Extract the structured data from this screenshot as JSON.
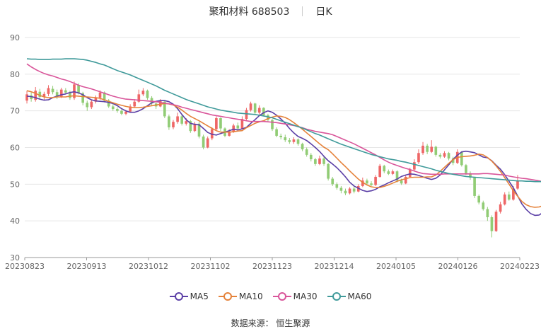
{
  "header": {
    "title": "聚和材料 688503",
    "period": "日K"
  },
  "source": "数据来源： 恒生聚源",
  "colors": {
    "up": "#ee6666",
    "down": "#91cc75",
    "ma5": "#5b3fa6",
    "ma10": "#e5823a",
    "ma30": "#d9559a",
    "ma60": "#3f9a9a",
    "grid": "#e6e6e6",
    "axis": "#666666"
  },
  "chart_data": {
    "type": "candlestick",
    "title": "聚和材料 688503",
    "subtitle": "日K",
    "ylim": [
      30,
      90
    ],
    "yticks": [
      30,
      40,
      50,
      60,
      70,
      80,
      90
    ],
    "xticks": [
      "20230823",
      "20230913",
      "20231012",
      "20231102",
      "20231123",
      "20231214",
      "20240105",
      "20240126",
      "20240223"
    ],
    "legend_position": "bottom",
    "grid": true,
    "candles": [
      {
        "o": 72.8,
        "c": 74.5,
        "h": 75.5,
        "l": 72.0
      },
      {
        "o": 74.2,
        "c": 73.2,
        "h": 75.0,
        "l": 72.5
      },
      {
        "o": 73.0,
        "c": 75.5,
        "h": 76.5,
        "l": 72.5
      },
      {
        "o": 75.2,
        "c": 73.8,
        "h": 76.0,
        "l": 73.2
      },
      {
        "o": 73.8,
        "c": 74.6,
        "h": 75.2,
        "l": 73.0
      },
      {
        "o": 74.6,
        "c": 76.2,
        "h": 77.0,
        "l": 74.0
      },
      {
        "o": 76.0,
        "c": 75.1,
        "h": 76.8,
        "l": 74.5
      },
      {
        "o": 75.1,
        "c": 73.8,
        "h": 75.8,
        "l": 73.2
      },
      {
        "o": 73.8,
        "c": 75.8,
        "h": 76.3,
        "l": 73.5
      },
      {
        "o": 75.6,
        "c": 75.0,
        "h": 76.2,
        "l": 74.5
      },
      {
        "o": 75.0,
        "c": 73.5,
        "h": 75.5,
        "l": 73.0
      },
      {
        "o": 73.5,
        "c": 77.2,
        "h": 78.0,
        "l": 73.0
      },
      {
        "o": 77.0,
        "c": 74.8,
        "h": 77.5,
        "l": 74.5
      },
      {
        "o": 74.8,
        "c": 72.2,
        "h": 75.2,
        "l": 71.5
      },
      {
        "o": 72.2,
        "c": 71.0,
        "h": 72.8,
        "l": 70.0
      },
      {
        "o": 71.0,
        "c": 72.5,
        "h": 73.0,
        "l": 70.5
      },
      {
        "o": 72.5,
        "c": 73.6,
        "h": 74.2,
        "l": 72.0
      },
      {
        "o": 73.6,
        "c": 75.0,
        "h": 75.6,
        "l": 73.0
      },
      {
        "o": 75.0,
        "c": 72.8,
        "h": 75.3,
        "l": 72.3
      },
      {
        "o": 72.8,
        "c": 71.2,
        "h": 73.2,
        "l": 70.8
      },
      {
        "o": 71.2,
        "c": 70.5,
        "h": 71.8,
        "l": 70.0
      },
      {
        "o": 70.5,
        "c": 70.0,
        "h": 71.0,
        "l": 69.5
      },
      {
        "o": 70.0,
        "c": 69.2,
        "h": 70.6,
        "l": 68.8
      },
      {
        "o": 69.2,
        "c": 69.8,
        "h": 70.2,
        "l": 68.8
      },
      {
        "o": 69.8,
        "c": 71.2,
        "h": 71.8,
        "l": 69.5
      },
      {
        "o": 71.2,
        "c": 72.5,
        "h": 73.2,
        "l": 71.0
      },
      {
        "o": 72.5,
        "c": 74.5,
        "h": 75.8,
        "l": 72.2
      },
      {
        "o": 74.5,
        "c": 75.5,
        "h": 76.2,
        "l": 74.0
      },
      {
        "o": 75.5,
        "c": 73.5,
        "h": 75.8,
        "l": 73.0
      },
      {
        "o": 73.5,
        "c": 72.0,
        "h": 74.0,
        "l": 71.5
      },
      {
        "o": 72.0,
        "c": 71.2,
        "h": 72.5,
        "l": 70.5
      },
      {
        "o": 71.2,
        "c": 72.8,
        "h": 73.2,
        "l": 71.0
      },
      {
        "o": 72.5,
        "c": 68.5,
        "h": 72.8,
        "l": 68.0
      },
      {
        "o": 68.5,
        "c": 65.5,
        "h": 69.0,
        "l": 64.8
      },
      {
        "o": 65.5,
        "c": 67.0,
        "h": 67.5,
        "l": 65.0
      },
      {
        "o": 67.0,
        "c": 68.5,
        "h": 69.5,
        "l": 66.5
      },
      {
        "o": 68.5,
        "c": 66.5,
        "h": 69.0,
        "l": 66.0
      },
      {
        "o": 66.5,
        "c": 67.2,
        "h": 68.0,
        "l": 66.0
      },
      {
        "o": 67.2,
        "c": 64.5,
        "h": 67.5,
        "l": 64.0
      },
      {
        "o": 64.5,
        "c": 66.5,
        "h": 67.0,
        "l": 64.2
      },
      {
        "o": 66.5,
        "c": 63.0,
        "h": 67.0,
        "l": 62.5
      },
      {
        "o": 63.0,
        "c": 60.0,
        "h": 63.5,
        "l": 59.5
      },
      {
        "o": 60.0,
        "c": 62.5,
        "h": 63.0,
        "l": 59.8
      },
      {
        "o": 62.5,
        "c": 65.0,
        "h": 65.5,
        "l": 62.0
      },
      {
        "o": 65.0,
        "c": 68.0,
        "h": 68.5,
        "l": 64.5
      },
      {
        "o": 68.0,
        "c": 65.2,
        "h": 68.2,
        "l": 64.5
      },
      {
        "o": 65.2,
        "c": 63.2,
        "h": 65.5,
        "l": 62.8
      },
      {
        "o": 63.2,
        "c": 64.2,
        "h": 65.0,
        "l": 63.0
      },
      {
        "o": 64.2,
        "c": 66.0,
        "h": 66.5,
        "l": 64.0
      },
      {
        "o": 66.0,
        "c": 65.2,
        "h": 66.8,
        "l": 64.8
      },
      {
        "o": 65.2,
        "c": 67.8,
        "h": 68.5,
        "l": 65.0
      },
      {
        "o": 67.8,
        "c": 70.2,
        "h": 70.8,
        "l": 67.5
      },
      {
        "o": 70.2,
        "c": 72.0,
        "h": 72.5,
        "l": 69.8
      },
      {
        "o": 72.0,
        "c": 69.5,
        "h": 72.2,
        "l": 69.0
      },
      {
        "o": 69.5,
        "c": 70.8,
        "h": 71.5,
        "l": 69.0
      },
      {
        "o": 70.8,
        "c": 68.8,
        "h": 71.0,
        "l": 68.5
      },
      {
        "o": 68.8,
        "c": 67.5,
        "h": 69.2,
        "l": 67.0
      },
      {
        "o": 67.5,
        "c": 65.0,
        "h": 67.8,
        "l": 64.5
      },
      {
        "o": 65.0,
        "c": 63.2,
        "h": 65.5,
        "l": 62.8
      },
      {
        "o": 63.2,
        "c": 62.8,
        "h": 63.8,
        "l": 62.2
      },
      {
        "o": 62.8,
        "c": 62.0,
        "h": 63.5,
        "l": 61.5
      },
      {
        "o": 62.0,
        "c": 61.5,
        "h": 62.6,
        "l": 61.0
      },
      {
        "o": 61.5,
        "c": 62.2,
        "h": 62.8,
        "l": 61.0
      },
      {
        "o": 62.2,
        "c": 61.0,
        "h": 62.5,
        "l": 60.5
      },
      {
        "o": 61.0,
        "c": 59.5,
        "h": 61.3,
        "l": 59.0
      },
      {
        "o": 59.5,
        "c": 58.0,
        "h": 60.0,
        "l": 57.5
      },
      {
        "o": 58.0,
        "c": 56.8,
        "h": 58.5,
        "l": 56.2
      },
      {
        "o": 56.8,
        "c": 55.5,
        "h": 57.2,
        "l": 55.0
      },
      {
        "o": 55.5,
        "c": 57.0,
        "h": 57.8,
        "l": 55.2
      },
      {
        "o": 57.0,
        "c": 55.5,
        "h": 57.5,
        "l": 55.0
      },
      {
        "o": 55.5,
        "c": 51.5,
        "h": 55.8,
        "l": 51.0
      },
      {
        "o": 51.5,
        "c": 50.0,
        "h": 52.0,
        "l": 49.5
      },
      {
        "o": 50.0,
        "c": 49.0,
        "h": 50.5,
        "l": 48.5
      },
      {
        "o": 49.0,
        "c": 48.2,
        "h": 49.5,
        "l": 47.5
      },
      {
        "o": 48.2,
        "c": 47.5,
        "h": 48.8,
        "l": 47.0
      },
      {
        "o": 47.5,
        "c": 48.8,
        "h": 49.2,
        "l": 47.2
      },
      {
        "o": 48.8,
        "c": 48.0,
        "h": 49.5,
        "l": 47.5
      },
      {
        "o": 48.0,
        "c": 49.5,
        "h": 50.0,
        "l": 47.8
      },
      {
        "o": 49.5,
        "c": 51.0,
        "h": 51.8,
        "l": 49.2
      },
      {
        "o": 51.0,
        "c": 50.2,
        "h": 51.5,
        "l": 49.8
      },
      {
        "o": 50.2,
        "c": 49.8,
        "h": 50.8,
        "l": 49.5
      },
      {
        "o": 49.8,
        "c": 52.0,
        "h": 52.5,
        "l": 49.5
      },
      {
        "o": 52.0,
        "c": 55.0,
        "h": 55.5,
        "l": 51.8
      },
      {
        "o": 55.0,
        "c": 53.5,
        "h": 55.3,
        "l": 53.0
      },
      {
        "o": 53.5,
        "c": 52.8,
        "h": 54.0,
        "l": 52.5
      },
      {
        "o": 52.8,
        "c": 53.5,
        "h": 54.0,
        "l": 52.5
      },
      {
        "o": 53.5,
        "c": 51.0,
        "h": 53.8,
        "l": 50.5
      },
      {
        "o": 51.0,
        "c": 50.2,
        "h": 51.5,
        "l": 49.8
      },
      {
        "o": 50.2,
        "c": 52.0,
        "h": 52.5,
        "l": 50.0
      },
      {
        "o": 52.0,
        "c": 54.0,
        "h": 54.5,
        "l": 51.8
      },
      {
        "o": 54.0,
        "c": 56.0,
        "h": 56.8,
        "l": 53.5
      },
      {
        "o": 56.0,
        "c": 58.5,
        "h": 59.5,
        "l": 55.5
      },
      {
        "o": 58.5,
        "c": 60.5,
        "h": 61.5,
        "l": 58.0
      },
      {
        "o": 60.5,
        "c": 58.8,
        "h": 61.0,
        "l": 58.2
      },
      {
        "o": 58.8,
        "c": 60.2,
        "h": 62.0,
        "l": 58.5
      },
      {
        "o": 60.2,
        "c": 58.0,
        "h": 60.5,
        "l": 57.5
      },
      {
        "o": 58.0,
        "c": 57.5,
        "h": 58.5,
        "l": 57.0
      },
      {
        "o": 57.5,
        "c": 58.5,
        "h": 59.0,
        "l": 57.2
      },
      {
        "o": 58.5,
        "c": 57.0,
        "h": 58.8,
        "l": 56.5
      },
      {
        "o": 57.0,
        "c": 55.8,
        "h": 57.5,
        "l": 55.2
      },
      {
        "o": 55.8,
        "c": 58.8,
        "h": 59.5,
        "l": 55.5
      },
      {
        "o": 58.8,
        "c": 55.2,
        "h": 59.0,
        "l": 54.8
      },
      {
        "o": 55.2,
        "c": 53.0,
        "h": 55.5,
        "l": 52.5
      },
      {
        "o": 53.0,
        "c": 51.8,
        "h": 53.5,
        "l": 51.2
      },
      {
        "o": 51.8,
        "c": 46.8,
        "h": 52.0,
        "l": 46.2
      },
      {
        "o": 46.8,
        "c": 45.0,
        "h": 47.2,
        "l": 44.5
      },
      {
        "o": 45.0,
        "c": 43.2,
        "h": 45.5,
        "l": 42.8
      },
      {
        "o": 43.2,
        "c": 41.0,
        "h": 43.8,
        "l": 40.0
      },
      {
        "o": 41.0,
        "c": 37.2,
        "h": 41.5,
        "l": 35.5
      },
      {
        "o": 37.2,
        "c": 42.5,
        "h": 43.0,
        "l": 37.0
      },
      {
        "o": 42.5,
        "c": 44.5,
        "h": 45.2,
        "l": 42.0
      },
      {
        "o": 44.5,
        "c": 47.2,
        "h": 47.8,
        "l": 44.2
      },
      {
        "o": 47.2,
        "c": 45.8,
        "h": 48.0,
        "l": 45.5
      },
      {
        "o": 45.8,
        "c": 48.8,
        "h": 49.5,
        "l": 45.5
      },
      {
        "o": 48.8,
        "c": 51.0,
        "h": 52.5,
        "l": 48.5
      }
    ],
    "series": [
      {
        "name": "MA5",
        "key": "ma5",
        "values": [
          74.0,
          73.9,
          73.6,
          73.2,
          72.9,
          73.0,
          73.6,
          74.0,
          74.4,
          74.6,
          75.0,
          75.2,
          74.9,
          74.4,
          73.6,
          73.0,
          72.7,
          72.6,
          72.5,
          72.3,
          72.0,
          71.4,
          70.6,
          70.0,
          69.6,
          69.6,
          70.0,
          70.6,
          71.4,
          72.2,
          72.6,
          72.8,
          72.8,
          72.5,
          71.8,
          70.6,
          69.0,
          67.6,
          66.6,
          66.3,
          66.2,
          65.2,
          64.1,
          63.6,
          63.4,
          63.8,
          64.2,
          64.6,
          65.0,
          64.8,
          65.1,
          65.5,
          66.6,
          67.6,
          68.7,
          69.5,
          70.0,
          69.6,
          68.8,
          67.8,
          66.6,
          65.2,
          64.0,
          63.0,
          62.5,
          61.9,
          61.0,
          60.0,
          58.9,
          57.6,
          56.4,
          55.5,
          54.5,
          53.3,
          52.0,
          50.5,
          49.5,
          48.9,
          48.3,
          48.0,
          48.2,
          48.6,
          49.3,
          49.8,
          50.4,
          50.9,
          51.4,
          52.1,
          52.5,
          52.8,
          52.7,
          52.4,
          52.0,
          51.6,
          51.3,
          51.6,
          52.5,
          53.9,
          55.3,
          56.8,
          57.9,
          58.8,
          59.0,
          58.8,
          58.6,
          58.0,
          57.4,
          57.2,
          56.4,
          55.2,
          54.1,
          52.6,
          50.8,
          49.0,
          46.8,
          44.6,
          43.1,
          42.0,
          41.5,
          41.6,
          42.4,
          44.0,
          45.7,
          47.1,
          48.6
        ]
      },
      {
        "name": "MA10",
        "key": "ma10",
        "values": [
          75.5,
          75.2,
          74.8,
          74.2,
          73.8,
          73.6,
          73.6,
          73.8,
          73.8,
          73.8,
          74.0,
          74.1,
          74.0,
          73.9,
          73.8,
          73.7,
          73.6,
          73.4,
          73.0,
          72.6,
          72.2,
          71.8,
          71.5,
          71.2,
          71.0,
          70.9,
          70.9,
          71.0,
          71.2,
          71.4,
          71.6,
          71.8,
          72.0,
          71.9,
          71.6,
          71.0,
          70.2,
          69.3,
          68.5,
          67.9,
          67.3,
          66.6,
          65.9,
          65.2,
          64.6,
          64.2,
          64.2,
          64.2,
          64.3,
          64.5,
          64.6,
          65.4,
          66.0,
          66.6,
          67.0,
          67.3,
          67.9,
          68.3,
          68.6,
          68.5,
          68.2,
          67.6,
          66.8,
          65.9,
          65.0,
          64.0,
          63.0,
          62.0,
          61.0,
          60.1,
          59.4,
          58.3,
          57.1,
          55.9,
          54.8,
          53.6,
          52.5,
          51.4,
          50.5,
          49.8,
          49.3,
          49.1,
          49.1,
          49.4,
          49.8,
          50.3,
          50.8,
          51.2,
          51.5,
          51.8,
          51.9,
          51.9,
          51.9,
          52.0,
          52.0,
          52.5,
          53.5,
          54.6,
          55.7,
          56.7,
          57.3,
          57.5,
          57.6,
          57.7,
          57.9,
          58.2,
          58.0,
          57.3,
          56.3,
          55.0,
          53.5,
          51.8,
          50.0,
          48.2,
          46.7,
          45.3,
          44.4,
          43.9,
          43.7,
          43.8,
          44.2,
          44.8,
          45.2
        ]
      },
      {
        "name": "MA30",
        "key": "ma30",
        "values": [
          82.8,
          82.0,
          81.3,
          80.7,
          80.2,
          79.8,
          79.5,
          79.1,
          78.7,
          78.4,
          78.0,
          77.5,
          77.0,
          76.6,
          76.3,
          76.0,
          75.6,
          75.2,
          74.8,
          74.4,
          74.0,
          73.7,
          73.4,
          73.2,
          73.1,
          73.0,
          72.9,
          72.8,
          72.7,
          72.6,
          72.5,
          72.3,
          72.1,
          71.9,
          71.7,
          71.4,
          71.0,
          70.7,
          70.4,
          70.1,
          69.8,
          69.5,
          69.2,
          68.9,
          68.7,
          68.5,
          68.3,
          68.1,
          67.9,
          67.7,
          67.5,
          67.3,
          67.1,
          67.1,
          67.1,
          67.1,
          67.0,
          66.9,
          66.8,
          66.6,
          66.4,
          66.2,
          66.0,
          65.7,
          65.4,
          65.0,
          64.7,
          64.4,
          64.2,
          64.0,
          63.8,
          63.5,
          63.0,
          62.5,
          62.0,
          61.5,
          61.0,
          60.4,
          59.8,
          59.2,
          58.6,
          58.0,
          57.3,
          56.6,
          56.0,
          55.5,
          55.1,
          54.7,
          54.3,
          54.0,
          53.6,
          53.2,
          52.9,
          52.8,
          52.7,
          52.7,
          52.7,
          52.8,
          52.8,
          52.8,
          52.8,
          52.8,
          52.8,
          52.8,
          52.8,
          52.8,
          52.9,
          52.9,
          52.8,
          52.7,
          52.6,
          52.5,
          52.2,
          52.0,
          51.8,
          51.6,
          51.5,
          51.3,
          51.1,
          50.9,
          50.7,
          50.6,
          50.5,
          50.5,
          50.5
        ]
      },
      {
        "name": "MA60",
        "key": "ma60",
        "values": [
          84.2,
          84.1,
          84.1,
          84.0,
          84.0,
          84.0,
          84.1,
          84.1,
          84.1,
          84.2,
          84.2,
          84.2,
          84.1,
          84.0,
          83.8,
          83.5,
          83.2,
          82.8,
          82.5,
          82.0,
          81.5,
          81.0,
          80.6,
          80.2,
          79.8,
          79.3,
          78.8,
          78.3,
          77.8,
          77.3,
          76.8,
          76.2,
          75.6,
          75.1,
          74.6,
          74.1,
          73.6,
          73.1,
          72.7,
          72.3,
          71.9,
          71.5,
          71.1,
          70.8,
          70.5,
          70.2,
          70.0,
          69.8,
          69.6,
          69.4,
          69.3,
          69.2,
          69.1,
          69.0,
          68.8,
          68.6,
          68.4,
          68.1,
          67.7,
          67.3,
          66.9,
          66.5,
          66.1,
          65.7,
          65.3,
          64.8,
          64.3,
          63.8,
          63.4,
          62.9,
          62.4,
          61.9,
          61.4,
          60.9,
          60.5,
          60.1,
          59.7,
          59.3,
          58.9,
          58.5,
          58.1,
          57.8,
          57.5,
          57.2,
          56.9,
          56.7,
          56.5,
          56.2,
          56.0,
          55.7,
          55.4,
          55.1,
          54.8,
          54.5,
          54.2,
          53.8,
          53.5,
          53.2,
          52.9,
          52.7,
          52.5,
          52.3,
          52.1,
          52.0,
          51.9,
          51.8,
          51.7,
          51.6,
          51.5,
          51.4,
          51.3,
          51.2,
          51.1,
          51.0,
          50.9,
          50.9,
          50.8,
          50.8,
          50.7,
          50.7,
          50.7,
          50.6,
          50.6,
          50.5,
          50.5
        ]
      }
    ]
  }
}
